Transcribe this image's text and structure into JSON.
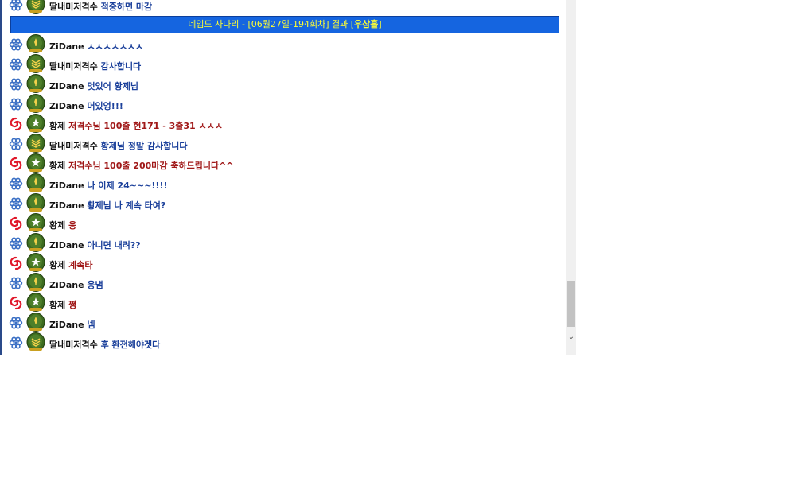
{
  "banner": {
    "prefix": "네임드 사다리 - [06월27일-194회차] 결과 [",
    "result": "우삼홀",
    "suffix": "]"
  },
  "colors": {
    "blue_team": "#3a6fc4",
    "red_team": "#e0182a",
    "blue_msg": "#1a3f9a",
    "red_msg": "#a01818",
    "banner_bg": "#1565e0",
    "banner_text": "#ffff33"
  },
  "messages": [
    {
      "team": "blue",
      "icon": "blue-flower-icon",
      "badge": "sergeant-chevron-badge-icon",
      "name": "딸내미저격수",
      "text": "적중하면 마감"
    },
    {
      "team": "blue",
      "icon": "blue-flower-icon",
      "badge": "green-helmet-badge-icon",
      "name": "ZiDane",
      "text": "ㅅㅅㅅㅅㅅㅅㅅ"
    },
    {
      "team": "blue",
      "icon": "blue-flower-icon",
      "badge": "sergeant-chevron-badge-icon",
      "name": "딸내미저격수",
      "text": "감사합니다"
    },
    {
      "team": "blue",
      "icon": "blue-flower-icon",
      "badge": "green-helmet-badge-icon",
      "name": "ZiDane",
      "text": "멋있어 황제님"
    },
    {
      "team": "blue",
      "icon": "blue-flower-icon",
      "badge": "green-helmet-badge-icon",
      "name": "ZiDane",
      "text": "머있엉!!!"
    },
    {
      "team": "red",
      "icon": "red-swirl-icon",
      "badge": "star-helmet-badge-icon",
      "name": "황제",
      "text": " 저격수님 100출 현171 - 3출31 ㅅㅅㅅ"
    },
    {
      "team": "blue",
      "icon": "blue-flower-icon",
      "badge": "sergeant-chevron-badge-icon",
      "name": "딸내미저격수",
      "text": "황제님 정말 감사합니다"
    },
    {
      "team": "red",
      "icon": "red-swirl-icon",
      "badge": "star-helmet-badge-icon",
      "name": "황제",
      "text": "저격수님 100출 200마감 축하드립니다^^"
    },
    {
      "team": "blue",
      "icon": "blue-flower-icon",
      "badge": "green-helmet-badge-icon",
      "name": "ZiDane",
      "text": "나 이제 24~~~!!!!"
    },
    {
      "team": "blue",
      "icon": "blue-flower-icon",
      "badge": "green-helmet-badge-icon",
      "name": "ZiDane",
      "text": "황제님 나 계속 타여?"
    },
    {
      "team": "red",
      "icon": "red-swirl-icon",
      "badge": "star-helmet-badge-icon",
      "name": "황제",
      "text": "응"
    },
    {
      "team": "blue",
      "icon": "blue-flower-icon",
      "badge": "green-helmet-badge-icon",
      "name": "ZiDane",
      "text": "아니면 내려??"
    },
    {
      "team": "red",
      "icon": "red-swirl-icon",
      "badge": "star-helmet-badge-icon",
      "name": "황제",
      "text": "계속타"
    },
    {
      "team": "blue",
      "icon": "blue-flower-icon",
      "badge": "green-helmet-badge-icon",
      "name": "ZiDane",
      "text": "웅냄"
    },
    {
      "team": "red",
      "icon": "red-swirl-icon",
      "badge": "star-helmet-badge-icon",
      "name": "황제",
      "text": "쪙"
    },
    {
      "team": "blue",
      "icon": "blue-flower-icon",
      "badge": "green-helmet-badge-icon",
      "name": "ZiDane",
      "text": "넴"
    },
    {
      "team": "blue",
      "icon": "blue-flower-icon",
      "badge": "sergeant-chevron-badge-icon",
      "name": "딸내미저격수",
      "text": "후 환전해야겟다"
    }
  ]
}
